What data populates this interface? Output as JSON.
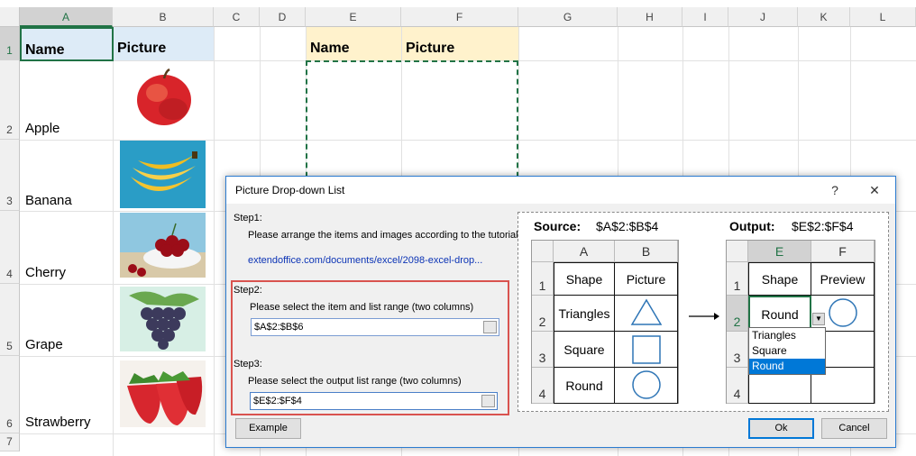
{
  "sheet": {
    "columns": [
      "A",
      "B",
      "C",
      "D",
      "E",
      "F",
      "G",
      "H",
      "I",
      "J",
      "K",
      "L"
    ],
    "rows": [
      "1",
      "2",
      "3",
      "4",
      "5",
      "6",
      "7"
    ],
    "a1": "Name",
    "b1": "Picture",
    "e1": "Name",
    "f1": "Picture",
    "fruits": [
      "Apple",
      "Banana",
      "Cherry",
      "Grape",
      "Strawberry"
    ]
  },
  "dialog": {
    "title": "Picture Drop-down List",
    "help": "?",
    "close": "✕",
    "step1": "Step1:",
    "step1_text": "Please arrange the items and images according to the tutorial",
    "step1_link": "extendoffice.com/documents/excel/2098-excel-drop...",
    "step2": "Step2:",
    "step2_text": "Please select the item and list range (two columns)",
    "step2_value": "$A$2:$B$6",
    "step3": "Step3:",
    "step3_text": "Please select the output list range (two columns)",
    "step3_value": "$E$2:$F$4",
    "example": "Example",
    "ok": "Ok",
    "cancel": "Cancel",
    "preview": {
      "source_label": "Source:",
      "source_range": "$A$2:$B$4",
      "output_label": "Output:",
      "output_range": "$E$2:$F$4",
      "src_cols": [
        "A",
        "B"
      ],
      "src_header": [
        "Shape",
        "Picture"
      ],
      "src_rows": [
        "1",
        "2",
        "3",
        "4"
      ],
      "shapes": [
        "Triangles",
        "Square",
        "Round"
      ],
      "out_cols": [
        "E",
        "F"
      ],
      "out_header": [
        "Shape",
        "Preview"
      ],
      "out_selected": "Round",
      "dropdown": [
        "Triangles",
        "Square",
        "Round"
      ]
    }
  },
  "colors": {
    "accent": "#217346",
    "dialog_border": "#2b7bd0",
    "header_blue": "#ddebf7",
    "header_yellow": "#fff2cc",
    "highlight": "#d9534f",
    "selection": "#0078d7"
  }
}
